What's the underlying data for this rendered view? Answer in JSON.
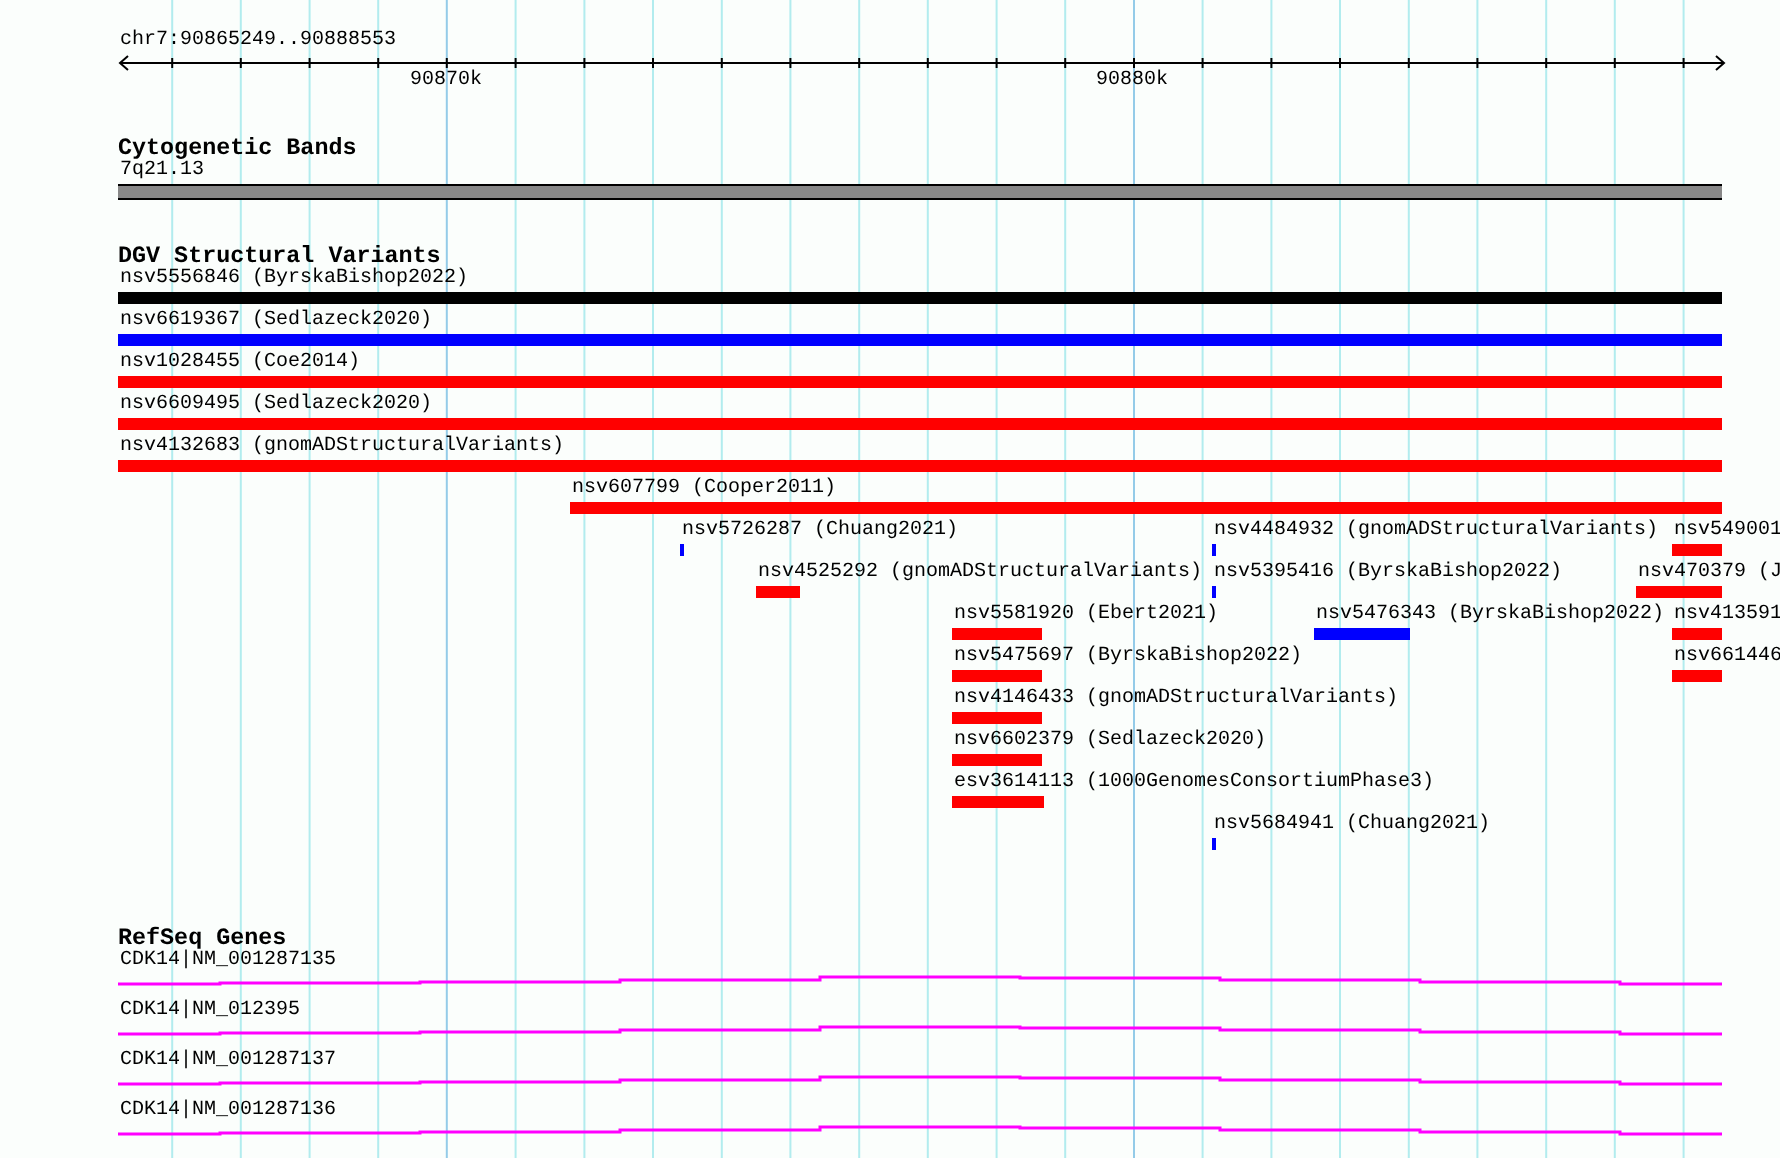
{
  "ruler": {
    "location": "chr7:90865249..90888553",
    "ticks": [
      "90870k",
      "90880k"
    ]
  },
  "tracks": [
    {
      "kind": "cytoband",
      "title": "Cytogenetic Bands",
      "features": [
        {
          "label": "7q21.13"
        }
      ]
    },
    {
      "kind": "variants",
      "title": "DGV Structural Variants",
      "features": [
        {
          "label": "nsv5556846 (ByrskaBishop2022)",
          "color": "#000000"
        },
        {
          "label": "nsv6619367 (Sedlazeck2020)",
          "color": "#0000ff"
        },
        {
          "label": "nsv1028455 (Coe2014)",
          "color": "#ff0000"
        },
        {
          "label": "nsv6609495 (Sedlazeck2020)",
          "color": "#ff0000"
        },
        {
          "label": "nsv4132683 (gnomADStructuralVariants)",
          "color": "#ff0000"
        },
        {
          "label": "nsv607799 (Cooper2011)",
          "color": "#ff0000"
        },
        {
          "label": "nsv5726287 (Chuang2021)",
          "color": "#0000ff"
        },
        {
          "label": "nsv4484932 (gnomADStructuralVariants)",
          "color": "#0000ff"
        },
        {
          "label": "nsv549001",
          "color": "#ff0000"
        },
        {
          "label": "nsv4525292 (gnomADStructuralVariants)",
          "color": "#ff0000"
        },
        {
          "label": "nsv5395416 (ByrskaBishop2022)",
          "color": "#0000ff"
        },
        {
          "label": "nsv470379 (J",
          "color": "#ff0000"
        },
        {
          "label": "nsv5581920 (Ebert2021)",
          "color": "#ff0000"
        },
        {
          "label": "nsv5476343 (ByrskaBishop2022)",
          "color": "#0000ff"
        },
        {
          "label": "nsv413591",
          "color": "#ff0000"
        },
        {
          "label": "nsv5475697 (ByrskaBishop2022)",
          "color": "#ff0000"
        },
        {
          "label": "nsv661446",
          "color": "#ff0000"
        },
        {
          "label": "nsv4146433 (gnomADStructuralVariants)",
          "color": "#ff0000"
        },
        {
          "label": "nsv6602379 (Sedlazeck2020)",
          "color": "#ff0000"
        },
        {
          "label": "esv3614113 (1000GenomesConsortiumPhase3)",
          "color": "#ff0000"
        },
        {
          "label": "nsv5684941 (Chuang2021)",
          "color": "#0000ff"
        }
      ]
    },
    {
      "kind": "genes",
      "title": "RefSeq Genes",
      "features": [
        {
          "label": "CDK14|NM_001287135"
        },
        {
          "label": "CDK14|NM_012395"
        },
        {
          "label": "CDK14|NM_001287137"
        },
        {
          "label": "CDK14|NM_001287136"
        }
      ]
    }
  ]
}
